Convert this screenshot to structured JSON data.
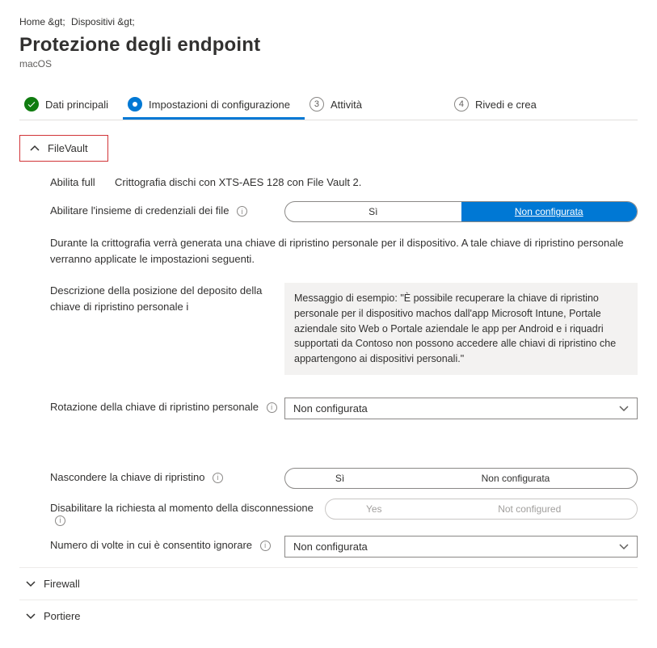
{
  "breadcrumb": {
    "home": "Home &gt;",
    "devices": "Dispositivi &gt;"
  },
  "title": "Protezione degli endpoint",
  "subtitle": "macOS",
  "steps": {
    "s1": "Dati principali",
    "s2": "Impostazioni di configurazione",
    "s3": "Attività",
    "s3n": "3",
    "s4": "Rivedi e crea",
    "s4n": "4"
  },
  "sections": {
    "filevault": "FileVault",
    "firewall": "Firewall",
    "portiere": "Portiere"
  },
  "fv": {
    "enable_label": "Abilita full",
    "enable_desc": "Crittografia dischi con XTS-AES 128 con File Vault 2.",
    "credset_label": "Abilitare l'insieme di credenziali dei file",
    "opt_yes": "Sì",
    "opt_notconf": "Non configurata",
    "key_note": "Durante la crittografia verrà generata una chiave di ripristino personale per il dispositivo. A tale chiave di ripristino personale verranno applicate le impostazioni seguenti.",
    "escrow_label": "Descrizione della posizione del deposito della chiave di ripristino personale",
    "escrow_placeholder": "Messaggio di esempio: \"È possibile recuperare la chiave di ripristino personale per il dispositivo machos dall'app Microsoft Intune, Portale aziendale sito Web o Portale aziendale le app per Android e i riquadri supportati da Contoso non possono accedere alle chiavi di ripristino che appartengono ai dispositivi personali.\"",
    "rotation_label": "Rotazione della chiave di ripristino personale",
    "rotation_value": "Non configurata",
    "hide_label": "Nascondere la chiave di ripristino",
    "disable_prompt_label": "Disabilitare la richiesta al momento della disconnessione",
    "disable_yes": "Yes",
    "disable_notconf": "Not configured",
    "bypass_label": "Numero di volte in cui è consentito ignorare",
    "bypass_value": "Non configurata"
  }
}
